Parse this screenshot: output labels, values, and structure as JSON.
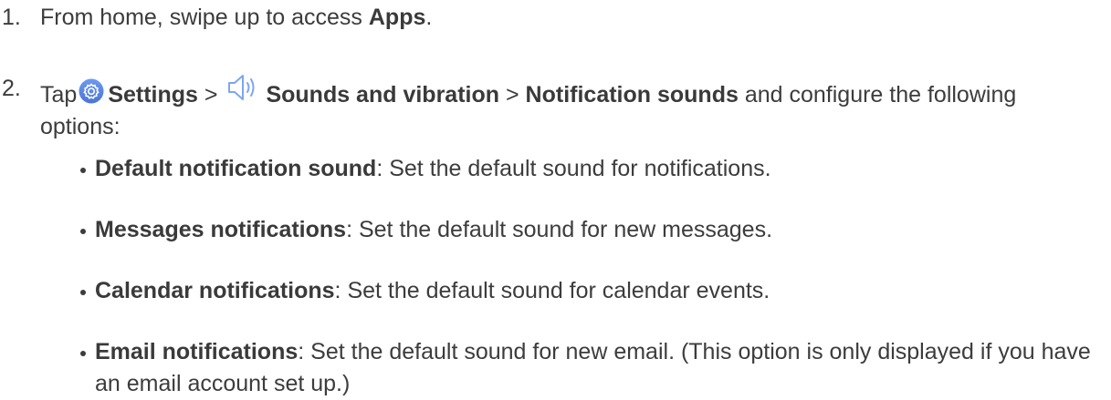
{
  "steps": [
    {
      "number": "1.",
      "text_before": "From home, swipe up to access ",
      "bold": "Apps",
      "text_after": "."
    },
    {
      "number": "2.",
      "tap": "Tap",
      "settings_icon": "settings-gear-icon",
      "settings_label": "Settings",
      "sep1": ">",
      "sound_icon": "speaker-icon",
      "sounds_label": "Sounds and vibration",
      "sep2": ">",
      "notification_label": "Notification sounds",
      "trailing": "and configure the following options:"
    }
  ],
  "options": [
    {
      "term": "Default notification sound",
      "description": ": Set the default sound for notifications."
    },
    {
      "term": "Messages notifications",
      "description": ": Set the default sound for new messages."
    },
    {
      "term": "Calendar notifications",
      "description": ": Set the default sound for calendar events."
    },
    {
      "term": "Email notifications",
      "description": ": Set the default sound for new email. (This option is only displayed if you have an email account set up.)"
    }
  ],
  "colors": {
    "text": "#3c3c3c",
    "settings_icon_bg": "#5a86e8",
    "speaker_icon": "#7ea6ee"
  }
}
